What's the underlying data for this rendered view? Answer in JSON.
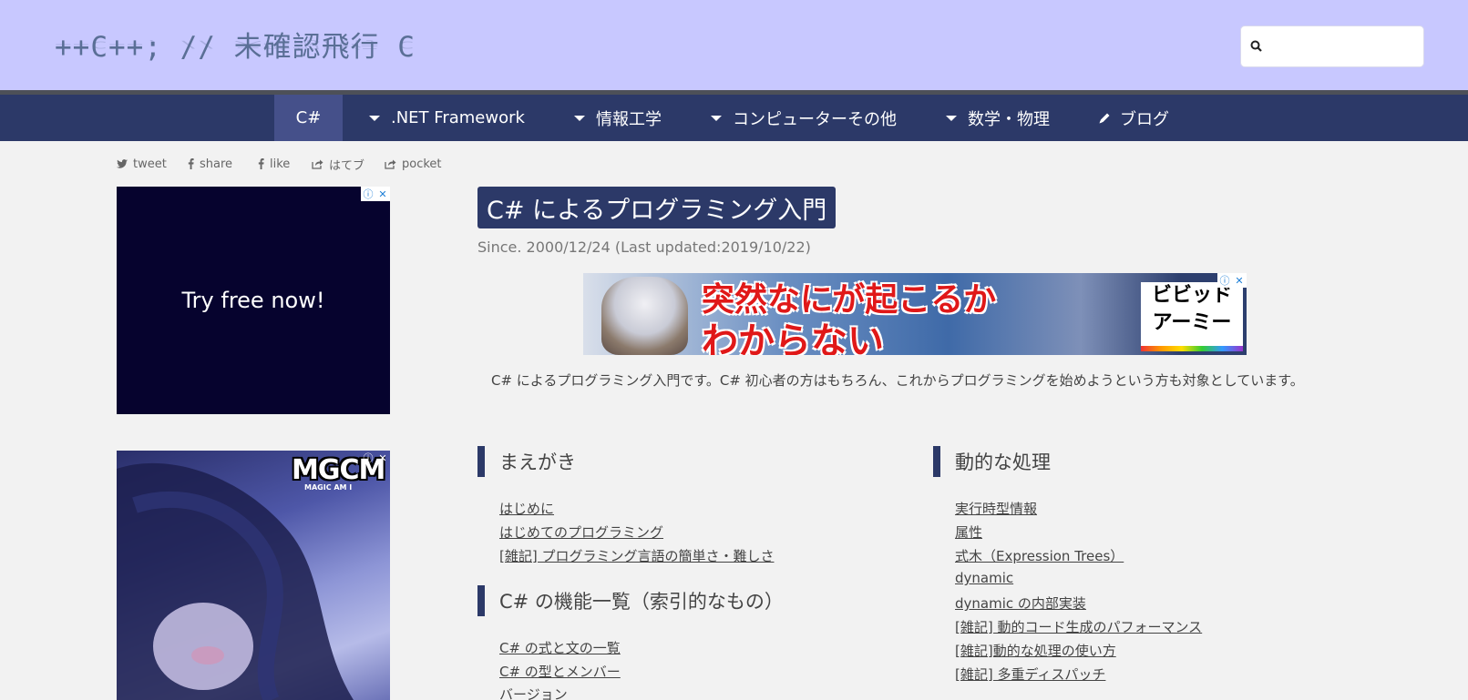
{
  "header": {
    "logo_text": "++C++; // 未確認飛行 C",
    "search": {
      "placeholder": "",
      "value": ""
    }
  },
  "nav": {
    "items": [
      {
        "label": "C#",
        "icon": "none",
        "active": true
      },
      {
        "label": ".NET Framework",
        "icon": "chevron-down-icon",
        "active": false
      },
      {
        "label": "情報工学",
        "icon": "chevron-down-icon",
        "active": false
      },
      {
        "label": "コンピューターその他",
        "icon": "chevron-down-icon",
        "active": false
      },
      {
        "label": "数学・物理",
        "icon": "chevron-down-icon",
        "active": false
      },
      {
        "label": "ブログ",
        "icon": "pencil-icon",
        "active": false
      }
    ]
  },
  "share": {
    "items": [
      {
        "label": "tweet",
        "icon": "twitter-icon"
      },
      {
        "label": "share",
        "icon": "facebook-icon"
      },
      {
        "label": "like",
        "icon": "facebook-icon"
      },
      {
        "label": "はてブ",
        "icon": "share-icon"
      },
      {
        "label": "pocket",
        "icon": "share-icon"
      }
    ]
  },
  "ads": {
    "left_top": {
      "text": "Try free now!"
    },
    "left_bottom": {
      "logo": "MGCM",
      "sub": "MAGIC AM I"
    },
    "banner": {
      "line1": "突然なにが起こるか",
      "line2": "わからない",
      "brand_line1": "ビビッド",
      "brand_line2": "アーミー"
    },
    "info_glyph": "ⓘ",
    "close_glyph": "✕"
  },
  "main": {
    "title": "C# によるプログラミング入門",
    "since": "Since. 2000/12/24 (Last updated:2019/10/22)",
    "intro": "C# によるプログラミング入門です。C# 初心者の方はもちろん、これからプログラミングを始めようという方も対象としています。",
    "sections": [
      {
        "heading": "まえがき",
        "links": [
          "はじめに",
          "はじめてのプログラミング",
          "[雑記] プログラミング言語の簡単さ・難しさ"
        ]
      },
      {
        "heading": "C# の機能一覧（索引的なもの）",
        "links": [
          "C# の式と文の一覧",
          "C# の型とメンバー",
          "バージョン"
        ]
      },
      {
        "heading": "動的な処理",
        "links": [
          "実行時型情報",
          "属性",
          "式木（Expression Trees）",
          "dynamic",
          "dynamic の内部実装",
          "[雑記] 動的コード生成のパフォーマンス",
          "[雑記]動的な処理の使い方",
          "[雑記] 多重ディスパッチ"
        ]
      }
    ]
  },
  "colors": {
    "header_bg": "#c8c8ff",
    "nav_bg": "#2c3968",
    "nav_active": "#45508a",
    "page_bg": "#f2f2f2"
  }
}
